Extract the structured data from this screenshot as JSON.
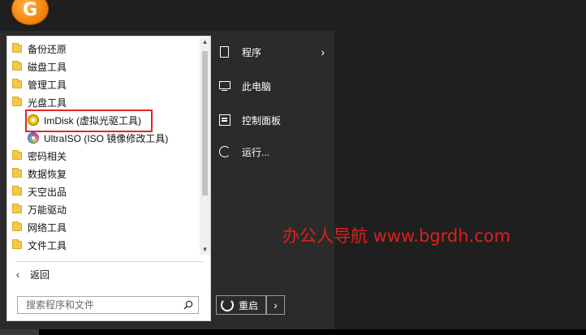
{
  "app": {
    "logo_letter": "G"
  },
  "tree": {
    "items": [
      {
        "label": "备份还原",
        "type": "folder",
        "indent": 0
      },
      {
        "label": "磁盘工具",
        "type": "folder",
        "indent": 0
      },
      {
        "label": "管理工具",
        "type": "folder",
        "indent": 0
      },
      {
        "label": "光盘工具",
        "type": "folder",
        "indent": 0
      },
      {
        "label": "ImDisk (虚拟光驱工具)",
        "type": "imdisk",
        "indent": 1,
        "highlighted": true
      },
      {
        "label": "UltraISO (ISO 镜像修改工具)",
        "type": "ultraiso",
        "indent": 1
      },
      {
        "label": "密码相关",
        "type": "folder",
        "indent": 0
      },
      {
        "label": "数据恢复",
        "type": "folder",
        "indent": 0
      },
      {
        "label": "天空出品",
        "type": "folder",
        "indent": 0
      },
      {
        "label": "万能驱动",
        "type": "folder",
        "indent": 0
      },
      {
        "label": "网络工具",
        "type": "folder",
        "indent": 0
      },
      {
        "label": "文件工具",
        "type": "folder",
        "indent": 0
      }
    ]
  },
  "back": {
    "label": "返回"
  },
  "search": {
    "placeholder": "搜索程序和文件"
  },
  "menu": {
    "programs": "程序",
    "this_pc": "此电脑",
    "control_panel": "控制面板",
    "run": "运行..."
  },
  "power": {
    "restart_label": "重启"
  },
  "watermark": "办公人导航  www.bgrdh.com",
  "colors": {
    "highlight": "#e02626",
    "watermark": "#e01f1f",
    "logo": "#f58a12"
  }
}
